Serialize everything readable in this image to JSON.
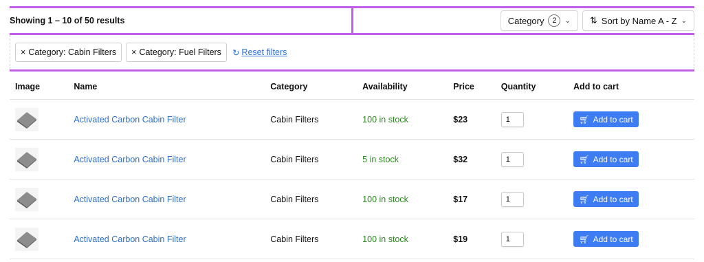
{
  "toolbar": {
    "results_text": "Showing 1 – 10 of 50 results",
    "category_label": "Category",
    "category_count": "2",
    "sort_label": "Sort by Name A - Z"
  },
  "filters": {
    "chips": [
      "Category: Cabin Filters",
      "Category: Fuel Filters"
    ],
    "reset_label": "Reset filters"
  },
  "table": {
    "headers": [
      "Image",
      "Name",
      "Category",
      "Availability",
      "Price",
      "Quantity",
      "Add to cart"
    ],
    "rows": [
      {
        "name": "Activated Carbon Cabin Filter",
        "category": "Cabin Filters",
        "availability": "100 in stock",
        "price": "$23",
        "qty": "1"
      },
      {
        "name": "Activated Carbon Cabin Filter",
        "category": "Cabin Filters",
        "availability": "5 in stock",
        "price": "$32",
        "qty": "1"
      },
      {
        "name": "Activated Carbon Cabin Filter",
        "category": "Cabin Filters",
        "availability": "100 in stock",
        "price": "$17",
        "qty": "1"
      },
      {
        "name": "Activated Carbon Cabin Filter",
        "category": "Cabin Filters",
        "availability": "100 in stock",
        "price": "$19",
        "qty": "1"
      }
    ],
    "add_to_cart_label": "Add to cart"
  },
  "colors": {
    "accent": "#3d7cf2",
    "link": "#2f6fc9",
    "in_stock": "#2b8a1e",
    "highlight": "#c15ee8"
  },
  "icons": {
    "chip_remove": "close-icon",
    "reset": "refresh-icon",
    "sort": "sort-icon",
    "dropdown": "chevron-down-icon",
    "cart": "cart-icon"
  }
}
